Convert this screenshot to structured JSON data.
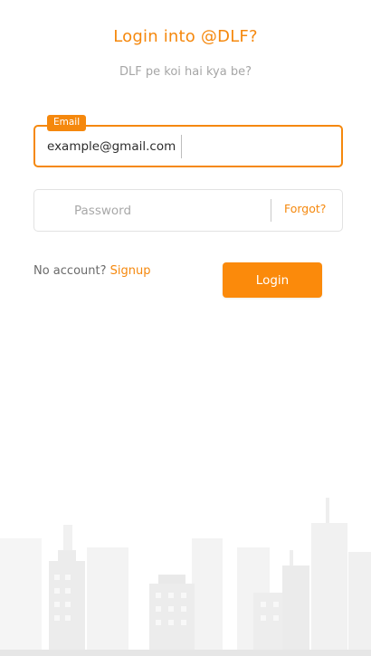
{
  "header": {
    "title": "Login into @DLF?",
    "subtitle": "DLF pe koi hai kya be?"
  },
  "form": {
    "email_label": "Email",
    "email_value": "example@gmail.com",
    "password_placeholder": "Password",
    "forgot_label": "Forgot?"
  },
  "footer_actions": {
    "no_account_text": "No account?",
    "signup_label": "Signup",
    "login_label": "Login"
  },
  "theme": {
    "accent": "#f5880d",
    "button": "#fb8a0b",
    "muted_text": "#a6a6a6"
  },
  "decor": {
    "illustration": "city-skyline-illustration"
  }
}
